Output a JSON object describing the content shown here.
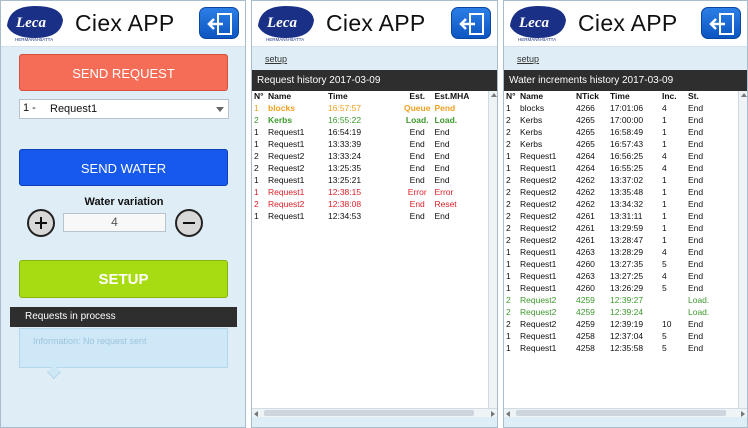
{
  "app": {
    "title": "Ciex APP",
    "logo_text": "Leca",
    "logo_subtext": "HERMANN-BATTA"
  },
  "panel1": {
    "send_request_label": "SEND REQUEST",
    "select": {
      "number": "1 -",
      "value": "Request1"
    },
    "send_water_label": "SEND WATER",
    "water_variation_label": "Water variation",
    "water_variation_value": "4",
    "setup_label": "SETUP",
    "requests_bar_label": "Requests in process",
    "info_text": "Information: No request sent"
  },
  "panel2": {
    "setup_link": "setup",
    "bar_title": "Request history 2017-03-09",
    "columns": [
      "N°",
      "Name",
      "Time",
      "Est.",
      "Est.MHA"
    ],
    "rows": [
      {
        "n": "1",
        "name": "blocks",
        "time": "16:57:57",
        "est": "Queue",
        "mha": "Pend",
        "status": "pending"
      },
      {
        "n": "2",
        "name": "Kerbs",
        "time": "16:55:22",
        "est": "Load.",
        "mha": "Load.",
        "status": "loading"
      },
      {
        "n": "1",
        "name": "Request1",
        "time": "16:54:19",
        "est": "End",
        "mha": "End",
        "status": "normal"
      },
      {
        "n": "1",
        "name": "Request1",
        "time": "13:33:39",
        "est": "End",
        "mha": "End",
        "status": "normal"
      },
      {
        "n": "2",
        "name": "Request2",
        "time": "13:33:24",
        "est": "End",
        "mha": "End",
        "status": "normal"
      },
      {
        "n": "2",
        "name": "Request2",
        "time": "13:25:35",
        "est": "End",
        "mha": "End",
        "status": "normal"
      },
      {
        "n": "1",
        "name": "Request1",
        "time": "13:25:21",
        "est": "End",
        "mha": "End",
        "status": "normal"
      },
      {
        "n": "1",
        "name": "Request1",
        "time": "12:38:15",
        "est": "Error",
        "mha": "Error",
        "status": "error"
      },
      {
        "n": "2",
        "name": "Request2",
        "time": "12:38:08",
        "est": "End",
        "mha": "Reset",
        "status": "error"
      },
      {
        "n": "1",
        "name": "Request1",
        "time": "12:34:53",
        "est": "End",
        "mha": "End",
        "status": "normal"
      }
    ]
  },
  "panel3": {
    "setup_link": "setup",
    "bar_title": "Water increments history 2017-03-09",
    "columns": [
      "N°",
      "Name",
      "NTick",
      "Time",
      "Inc.",
      "St."
    ],
    "rows": [
      {
        "n": "1",
        "name": "blocks",
        "ntick": "4266",
        "time": "17:01:06",
        "inc": "4",
        "st": "End",
        "status": "normal"
      },
      {
        "n": "2",
        "name": "Kerbs",
        "ntick": "4265",
        "time": "17:00:00",
        "inc": "1",
        "st": "End",
        "status": "normal"
      },
      {
        "n": "2",
        "name": "Kerbs",
        "ntick": "4265",
        "time": "16:58:49",
        "inc": "1",
        "st": "End",
        "status": "normal"
      },
      {
        "n": "2",
        "name": "Kerbs",
        "ntick": "4265",
        "time": "16:57:43",
        "inc": "1",
        "st": "End",
        "status": "normal"
      },
      {
        "n": "1",
        "name": "Request1",
        "ntick": "4264",
        "time": "16:56:25",
        "inc": "4",
        "st": "End",
        "status": "normal"
      },
      {
        "n": "1",
        "name": "Request1",
        "ntick": "4264",
        "time": "16:55:25",
        "inc": "4",
        "st": "End",
        "status": "normal"
      },
      {
        "n": "2",
        "name": "Request2",
        "ntick": "4262",
        "time": "13:37:02",
        "inc": "1",
        "st": "End",
        "status": "normal"
      },
      {
        "n": "2",
        "name": "Request2",
        "ntick": "4262",
        "time": "13:35:48",
        "inc": "1",
        "st": "End",
        "status": "normal"
      },
      {
        "n": "2",
        "name": "Request2",
        "ntick": "4262",
        "time": "13:34:32",
        "inc": "1",
        "st": "End",
        "status": "normal"
      },
      {
        "n": "2",
        "name": "Request2",
        "ntick": "4261",
        "time": "13:31:11",
        "inc": "1",
        "st": "End",
        "status": "normal"
      },
      {
        "n": "2",
        "name": "Request2",
        "ntick": "4261",
        "time": "13:29:59",
        "inc": "1",
        "st": "End",
        "status": "normal"
      },
      {
        "n": "2",
        "name": "Request2",
        "ntick": "4261",
        "time": "13:28:47",
        "inc": "1",
        "st": "End",
        "status": "normal"
      },
      {
        "n": "1",
        "name": "Request1",
        "ntick": "4263",
        "time": "13:28:29",
        "inc": "4",
        "st": "End",
        "status": "normal"
      },
      {
        "n": "1",
        "name": "Request1",
        "ntick": "4260",
        "time": "13:27:35",
        "inc": "5",
        "st": "End",
        "status": "normal"
      },
      {
        "n": "1",
        "name": "Request1",
        "ntick": "4263",
        "time": "13:27:25",
        "inc": "4",
        "st": "End",
        "status": "normal"
      },
      {
        "n": "1",
        "name": "Request1",
        "ntick": "4260",
        "time": "13:26:29",
        "inc": "5",
        "st": "End",
        "status": "normal"
      },
      {
        "n": "2",
        "name": "Request2",
        "ntick": "4259",
        "time": "12:39:27",
        "inc": "",
        "st": "Load.",
        "status": "loading"
      },
      {
        "n": "2",
        "name": "Request2",
        "ntick": "4259",
        "time": "12:39:24",
        "inc": "",
        "st": "Load.",
        "status": "loading"
      },
      {
        "n": "2",
        "name": "Request2",
        "ntick": "4259",
        "time": "12:39:19",
        "inc": "10",
        "st": "End",
        "status": "normal"
      },
      {
        "n": "1",
        "name": "Request1",
        "ntick": "4258",
        "time": "12:37:04",
        "inc": "5",
        "st": "End",
        "status": "normal"
      },
      {
        "n": "1",
        "name": "Request1",
        "ntick": "4258",
        "time": "12:35:58",
        "inc": "5",
        "st": "End",
        "status": "normal"
      }
    ]
  },
  "colors": {
    "send_request": "#f56d57",
    "send_water": "#1759ec",
    "setup": "#a8dc12",
    "exit_button": "#1a6ad8",
    "bar": "#2e2e2e",
    "pending": "#f0a020",
    "loading": "#3c9a2c",
    "error": "#e0202a",
    "normal": "#111111"
  },
  "icons": {
    "exit": "exit-arrow-icon",
    "plus": "plus-icon",
    "minus": "minus-icon",
    "dropdown": "chevron-down-icon"
  }
}
